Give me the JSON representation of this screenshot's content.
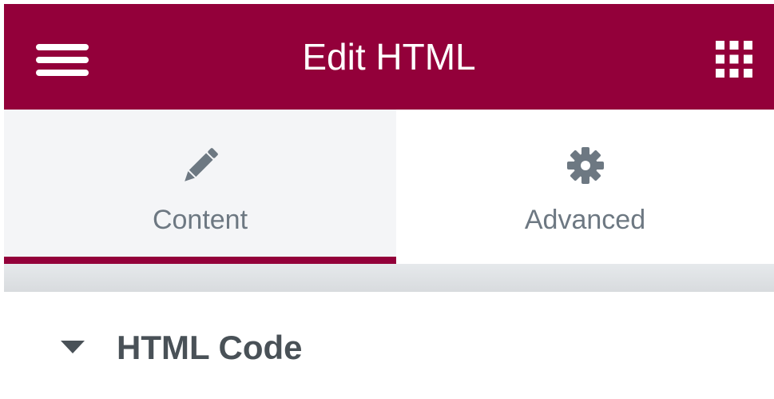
{
  "header": {
    "title": "Edit HTML",
    "menu_icon": "hamburger-menu-icon",
    "widgets_icon": "grid-icon",
    "background_color": "#93003a"
  },
  "tabs": [
    {
      "label": "Content",
      "icon": "pencil-icon",
      "active": true
    },
    {
      "label": "Advanced",
      "icon": "gear-icon",
      "active": false
    }
  ],
  "section": {
    "title": "HTML Code",
    "icon": "caret-down-icon",
    "expanded": true
  },
  "colors": {
    "accent": "#93003a",
    "tab_label": "#6d7882",
    "section_title": "#495157"
  }
}
